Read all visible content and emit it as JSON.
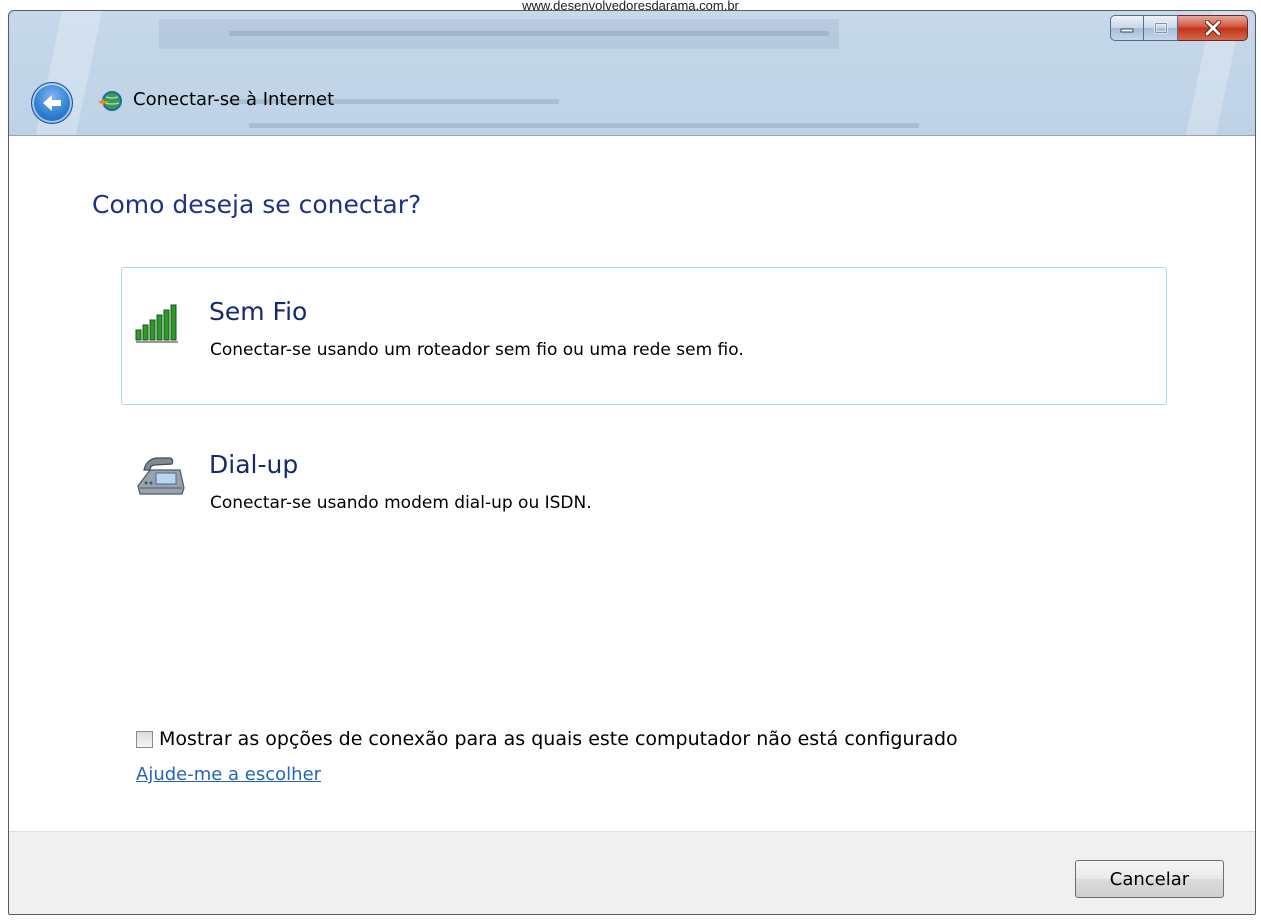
{
  "watermark": "www.desenvolvedoresdarama.com.br",
  "window": {
    "title": "Conectar-se à Internet",
    "controls": {
      "minimize": "minimize",
      "maximize": "maximize",
      "close": "close"
    }
  },
  "main": {
    "heading": "Como deseja se conectar?",
    "options": [
      {
        "title": "Sem Fio",
        "description": "Conectar-se usando um roteador sem fio ou uma rede sem fio.",
        "icon": "wireless-signal-icon",
        "selected": true
      },
      {
        "title": "Dial-up",
        "description": "Conectar-se usando modem dial-up ou ISDN.",
        "icon": "telephone-modem-icon",
        "selected": false
      }
    ],
    "show_options_label": "Mostrar as opções de conexão para as quais este computador não está configurado",
    "show_options_checked": false,
    "help_link": "Ajude-me a escolher"
  },
  "footer": {
    "cancel_label": "Cancelar"
  },
  "colors": {
    "heading": "#1e3287",
    "link": "#2367b4",
    "selection_border": "#a7d8ea",
    "signal": "#2f9a2a"
  }
}
